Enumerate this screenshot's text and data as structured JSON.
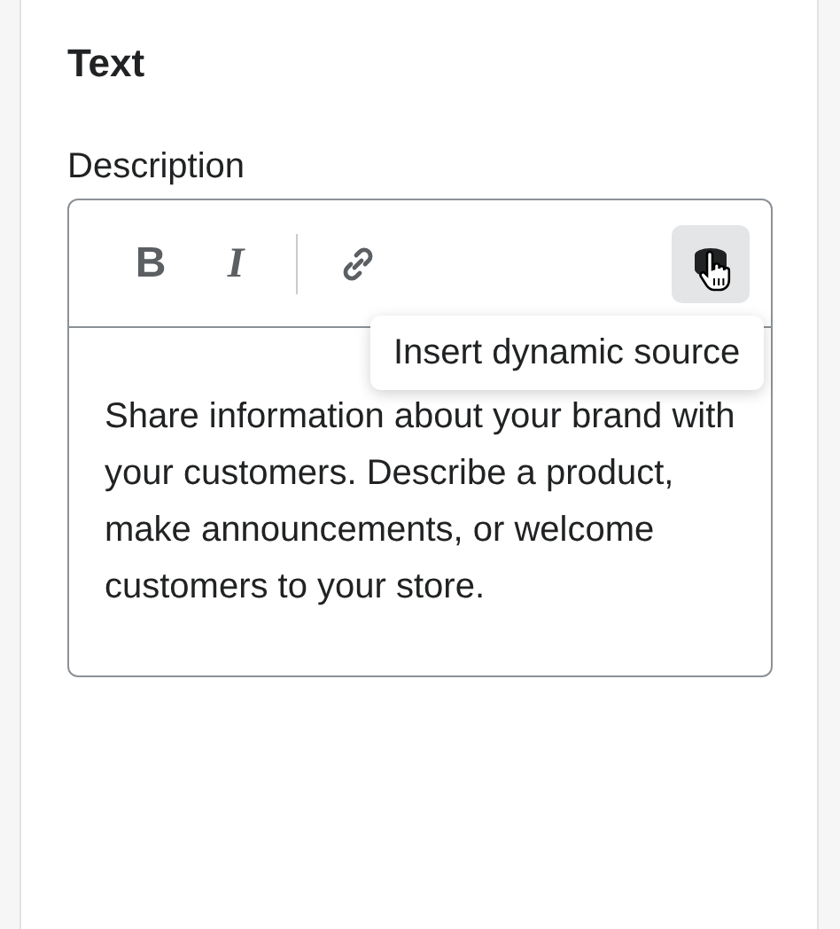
{
  "panel": {
    "title": "Text"
  },
  "field": {
    "label": "Description",
    "toolbar": [
      {
        "kind": "bold",
        "label": "B",
        "hovered": false
      },
      {
        "kind": "italic",
        "label": "I",
        "hovered": false
      },
      {
        "kind": "divider"
      },
      {
        "kind": "link",
        "hovered": false
      },
      {
        "kind": "dynamic",
        "hovered": true
      }
    ],
    "tooltip": "Insert dynamic source",
    "value": "Share information about your brand with your customers. Describe a product, make announcements, or welcome customers to your store."
  }
}
